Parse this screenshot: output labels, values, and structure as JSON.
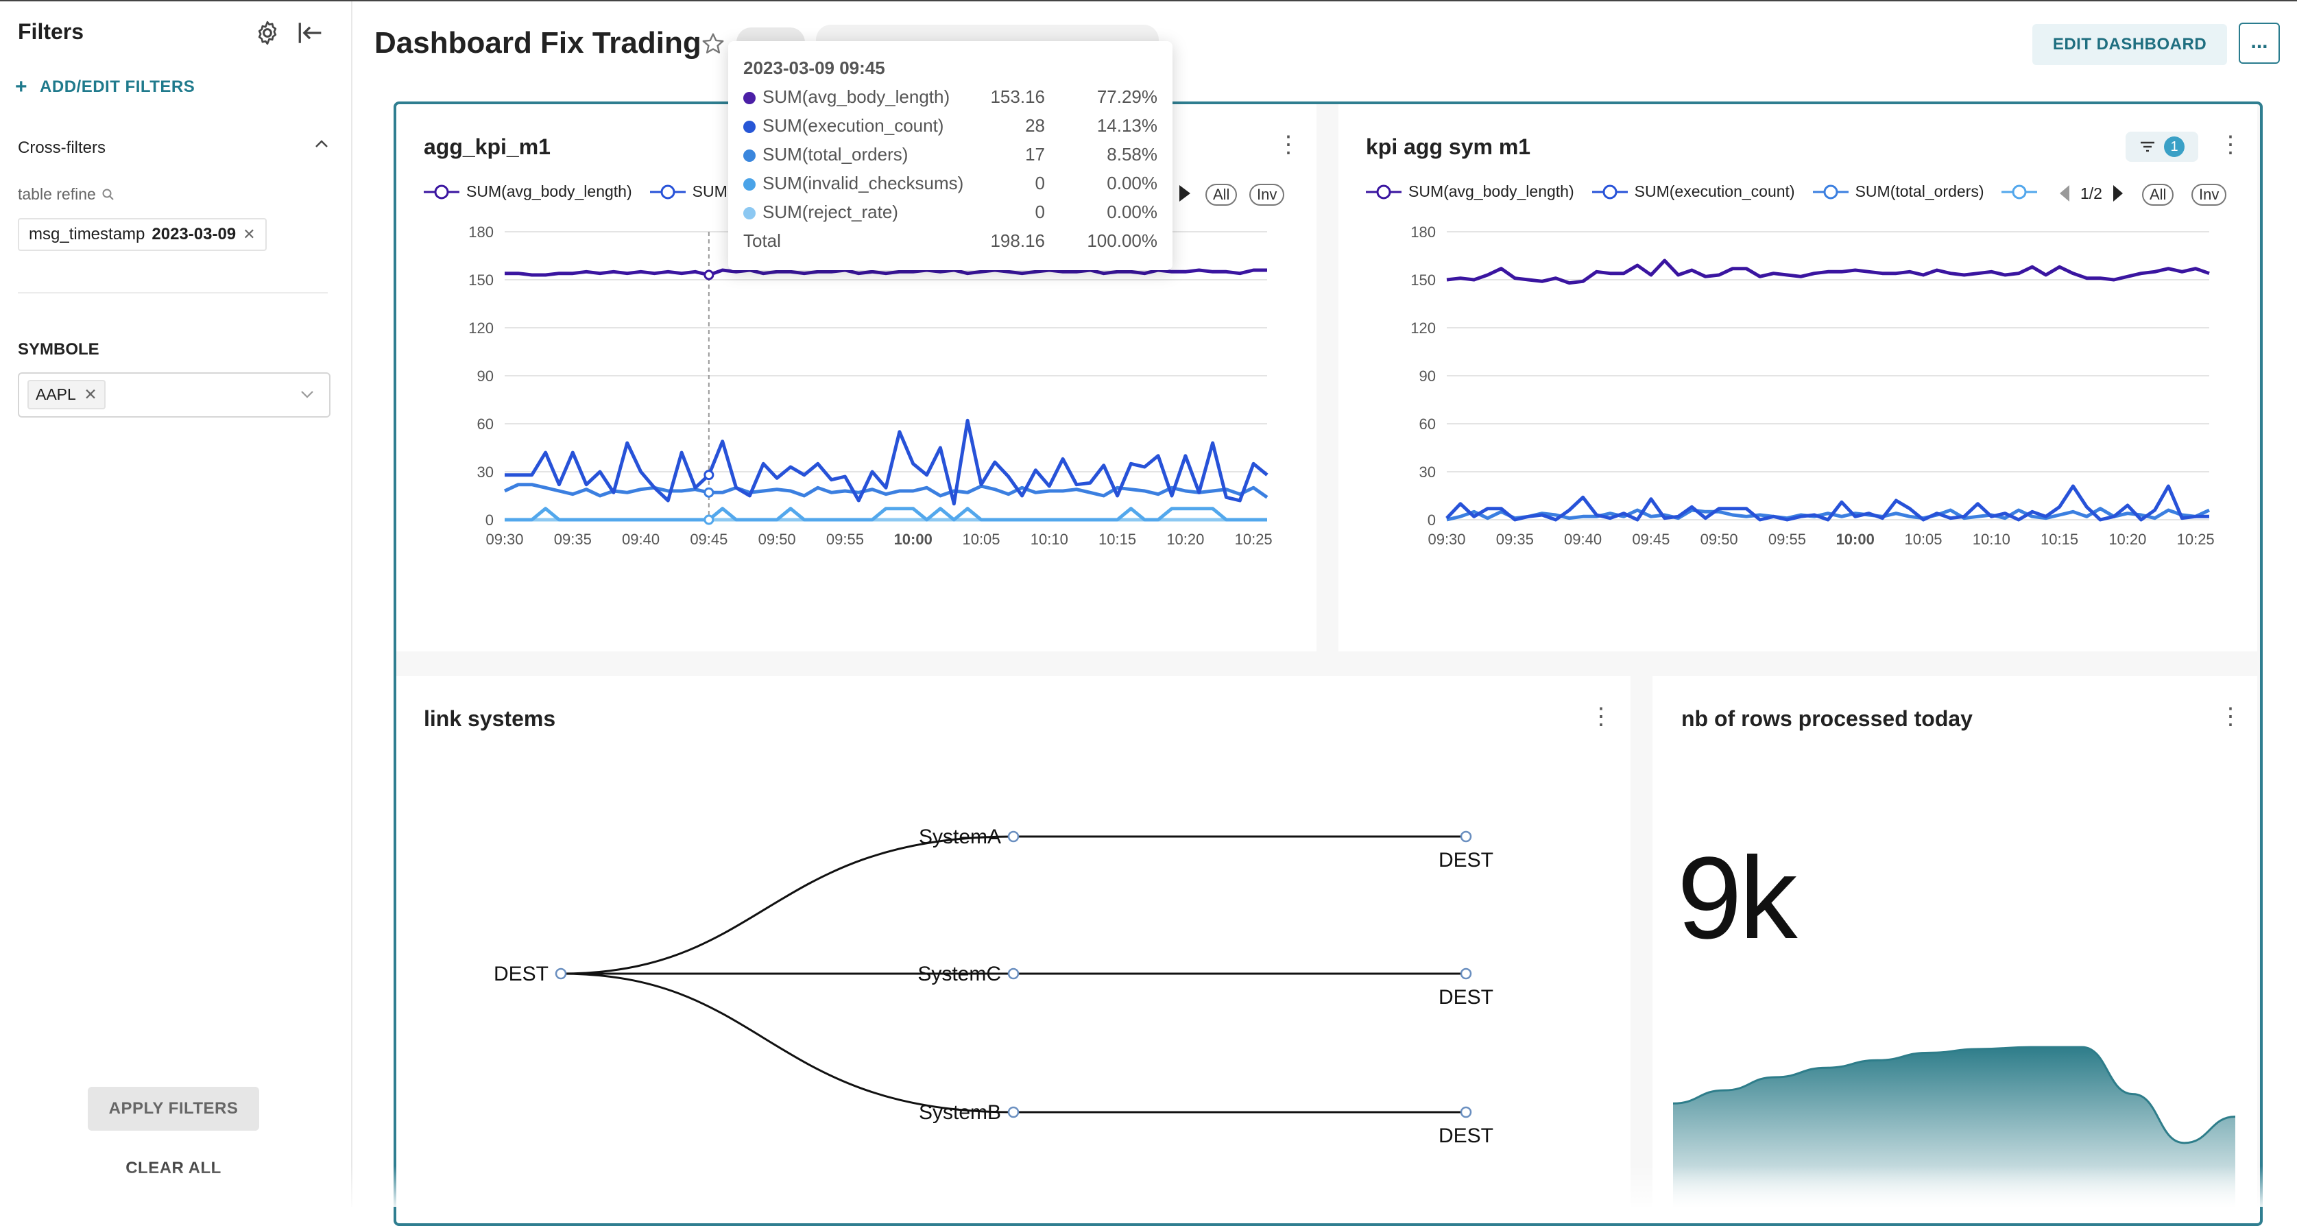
{
  "sidebar": {
    "title": "Filters",
    "add_edit": "ADD/EDIT FILTERS",
    "cross_filters_label": "Cross-filters",
    "table_refine_label": "table refine",
    "cross_filter_chip": {
      "field": "msg_timestamp",
      "value": "2023-03-09"
    },
    "symbole_label": "SYMBOLE",
    "symbole_tag": "AAPL",
    "apply_label": "APPLY FILTERS",
    "clear_label": "CLEAR ALL"
  },
  "header": {
    "title": "Dashboard Fix Trading",
    "edit_label": "EDIT DASHBOARD",
    "more_label": "..."
  },
  "tooltip": {
    "date": "2023-03-09 09:45",
    "rows": [
      {
        "label": "SUM(avg_body_length)",
        "value": "153.16",
        "pct": "77.29%",
        "color": "#4b1fa6"
      },
      {
        "label": "SUM(execution_count)",
        "value": "28",
        "pct": "14.13%",
        "color": "#2756d6"
      },
      {
        "label": "SUM(total_orders)",
        "value": "17",
        "pct": "8.58%",
        "color": "#3a86dd"
      },
      {
        "label": "SUM(invalid_checksums)",
        "value": "0",
        "pct": "0.00%",
        "color": "#4aa3e8"
      },
      {
        "label": "SUM(reject_rate)",
        "value": "0",
        "pct": "0.00%",
        "color": "#8cc8f2"
      }
    ],
    "total_label": "Total",
    "total_value": "198.16",
    "total_pct": "100.00%"
  },
  "chart1": {
    "title": "agg_kpi_m1",
    "legend": [
      "SUM(avg_body_length)",
      "SUM"
    ],
    "all_label": "All",
    "inv_label": "Inv"
  },
  "chart2": {
    "title": "kpi agg sym m1",
    "filter_count": "1",
    "legend": [
      "SUM(avg_body_length)",
      "SUM(execution_count)",
      "SUM(total_orders)"
    ],
    "page_label": "1/2",
    "all_label": "All",
    "inv_label": "Inv"
  },
  "link_systems": {
    "title": "link systems",
    "root": "DEST",
    "systems": [
      "SystemA",
      "SystemC",
      "SystemB"
    ],
    "leaf": "DEST"
  },
  "rows_card": {
    "title": "nb of rows processed today",
    "value": "9k"
  },
  "colors": {
    "accent": "#1f7a8c",
    "series_body": "#3a15a0",
    "series_exec": "#2752d8",
    "series_orders": "#3b7fe0",
    "series_invalid": "#52a7ec",
    "series_reject": "#8cc8f2",
    "area": "#2e7d8a"
  },
  "chart_data": [
    {
      "type": "line",
      "title": "agg_kpi_m1",
      "x": [
        "09:30",
        "09:31",
        "09:32",
        "09:33",
        "09:34",
        "09:35",
        "09:36",
        "09:37",
        "09:38",
        "09:39",
        "09:40",
        "09:41",
        "09:42",
        "09:43",
        "09:44",
        "09:45",
        "09:46",
        "09:47",
        "09:48",
        "09:49",
        "09:50",
        "09:51",
        "09:52",
        "09:53",
        "09:54",
        "09:55",
        "09:56",
        "09:57",
        "09:58",
        "09:59",
        "10:00",
        "10:01",
        "10:02",
        "10:03",
        "10:04",
        "10:05",
        "10:06",
        "10:07",
        "10:08",
        "10:09",
        "10:10",
        "10:11",
        "10:12",
        "10:13",
        "10:14",
        "10:15",
        "10:16",
        "10:17",
        "10:18",
        "10:19",
        "10:20",
        "10:21",
        "10:22",
        "10:23",
        "10:24",
        "10:25",
        "10:26"
      ],
      "x_ticks": [
        "09:30",
        "09:35",
        "09:40",
        "09:45",
        "09:50",
        "09:55",
        "10:00",
        "10:05",
        "10:10",
        "10:15",
        "10:20",
        "10:25"
      ],
      "ylim": [
        0,
        180
      ],
      "y_ticks": [
        0,
        30,
        60,
        90,
        120,
        150,
        180
      ],
      "series": [
        {
          "name": "SUM(avg_body_length)",
          "values": [
            154,
            154,
            153,
            153,
            154,
            154,
            155,
            154,
            155,
            154,
            155,
            154,
            155,
            154,
            155,
            153,
            156,
            155,
            156,
            154,
            155,
            155,
            154,
            155,
            155,
            156,
            154,
            155,
            154,
            155,
            155,
            156,
            155,
            156,
            154,
            155,
            156,
            155,
            154,
            155,
            156,
            155,
            155,
            156,
            154,
            155,
            155,
            154,
            156,
            155,
            155,
            156,
            155,
            155,
            154,
            156,
            156
          ]
        },
        {
          "name": "SUM(execution_count)",
          "values": [
            28,
            28,
            28,
            42,
            22,
            42,
            22,
            30,
            17,
            48,
            30,
            20,
            12,
            42,
            20,
            28,
            49,
            20,
            15,
            35,
            26,
            33,
            28,
            35,
            25,
            27,
            12,
            30,
            20,
            55,
            35,
            28,
            45,
            10,
            62,
            22,
            36,
            27,
            15,
            31,
            21,
            38,
            22,
            23,
            34,
            15,
            35,
            33,
            40,
            15,
            40,
            17,
            48,
            14,
            12,
            35,
            28
          ]
        },
        {
          "name": "SUM(total_orders)",
          "values": [
            18,
            22,
            22,
            20,
            18,
            16,
            19,
            15,
            18,
            17,
            19,
            20,
            18,
            18,
            19,
            17,
            17,
            20,
            17,
            18,
            19,
            18,
            15,
            20,
            17,
            18,
            17,
            19,
            16,
            18,
            18,
            20,
            15,
            18,
            17,
            21,
            19,
            16,
            20,
            17,
            18,
            18,
            19,
            17,
            15,
            20,
            19,
            18,
            16,
            20,
            18,
            17,
            18,
            19,
            16,
            20,
            14
          ]
        },
        {
          "name": "SUM(invalid_checksums)",
          "values": [
            0,
            0,
            0,
            7,
            0,
            0,
            0,
            0,
            0,
            0,
            0,
            0,
            0,
            0,
            0,
            0,
            7,
            0,
            0,
            0,
            0,
            7,
            0,
            0,
            0,
            0,
            0,
            0,
            7,
            7,
            7,
            0,
            7,
            0,
            7,
            0,
            0,
            0,
            0,
            0,
            0,
            0,
            0,
            0,
            0,
            0,
            7,
            0,
            0,
            7,
            7,
            7,
            7,
            0,
            0,
            0,
            0
          ]
        },
        {
          "name": "SUM(reject_rate)",
          "values": [
            0,
            0,
            0,
            0,
            0,
            0,
            0,
            0,
            0,
            0,
            0,
            0,
            0,
            0,
            0,
            0,
            0,
            0,
            0,
            0,
            0,
            0,
            0,
            0,
            0,
            0,
            0,
            0,
            0,
            0,
            0,
            0,
            0,
            0,
            0,
            0,
            0,
            0,
            0,
            0,
            0,
            0,
            0,
            0,
            0,
            0,
            0,
            0,
            0,
            0,
            0,
            0,
            0,
            0,
            0,
            0,
            0
          ]
        }
      ]
    },
    {
      "type": "line",
      "title": "kpi agg sym m1",
      "x": [
        "09:30",
        "09:31",
        "09:32",
        "09:33",
        "09:34",
        "09:35",
        "09:36",
        "09:37",
        "09:38",
        "09:39",
        "09:40",
        "09:41",
        "09:42",
        "09:43",
        "09:44",
        "09:45",
        "09:46",
        "09:47",
        "09:48",
        "09:49",
        "09:50",
        "09:51",
        "09:52",
        "09:53",
        "09:54",
        "09:55",
        "09:56",
        "09:57",
        "09:58",
        "09:59",
        "10:00",
        "10:01",
        "10:02",
        "10:03",
        "10:04",
        "10:05",
        "10:06",
        "10:07",
        "10:08",
        "10:09",
        "10:10",
        "10:11",
        "10:12",
        "10:13",
        "10:14",
        "10:15",
        "10:16",
        "10:17",
        "10:18",
        "10:19",
        "10:20",
        "10:21",
        "10:22",
        "10:23",
        "10:24",
        "10:25",
        "10:26"
      ],
      "x_ticks": [
        "09:30",
        "09:35",
        "09:40",
        "09:45",
        "09:50",
        "09:55",
        "10:00",
        "10:05",
        "10:10",
        "10:15",
        "10:20",
        "10:25"
      ],
      "ylim": [
        0,
        180
      ],
      "y_ticks": [
        0,
        30,
        60,
        90,
        120,
        150,
        180
      ],
      "series": [
        {
          "name": "SUM(avg_body_length)",
          "values": [
            150,
            151,
            150,
            153,
            157,
            151,
            150,
            149,
            151,
            148,
            149,
            155,
            154,
            154,
            159,
            153,
            162,
            153,
            156,
            152,
            153,
            157,
            157,
            152,
            154,
            153,
            152,
            154,
            155,
            155,
            156,
            155,
            154,
            154,
            155,
            153,
            156,
            154,
            153,
            154,
            155,
            153,
            154,
            158,
            153,
            158,
            154,
            151,
            151,
            150,
            152,
            154,
            155,
            157,
            155,
            157,
            154
          ]
        },
        {
          "name": "SUM(execution_count)",
          "values": [
            1,
            10,
            2,
            7,
            7,
            0,
            2,
            3,
            0,
            6,
            14,
            3,
            1,
            4,
            0,
            13,
            1,
            2,
            8,
            1,
            7,
            7,
            7,
            0,
            2,
            0,
            2,
            3,
            0,
            11,
            2,
            4,
            1,
            12,
            7,
            0,
            4,
            1,
            2,
            10,
            2,
            4,
            0,
            5,
            2,
            8,
            21,
            8,
            0,
            2,
            9,
            0,
            6,
            21,
            1,
            2,
            2
          ]
        },
        {
          "name": "SUM(total_orders)",
          "values": [
            0,
            2,
            5,
            1,
            5,
            1,
            2,
            4,
            3,
            1,
            2,
            2,
            4,
            2,
            6,
            2,
            3,
            1,
            6,
            5,
            5,
            3,
            2,
            3,
            2,
            1,
            3,
            2,
            4,
            2,
            4,
            3,
            2,
            4,
            2,
            1,
            3,
            6,
            1,
            2,
            3,
            1,
            6,
            2,
            1,
            3,
            5,
            2,
            7,
            2,
            4,
            3,
            1,
            6,
            3,
            2,
            6
          ]
        }
      ]
    },
    {
      "type": "area",
      "title": "nb of rows processed today",
      "x": [
        0,
        1,
        2,
        3,
        4,
        5,
        6,
        7,
        8,
        9,
        10,
        11
      ],
      "values": [
        0.55,
        0.62,
        0.69,
        0.74,
        0.78,
        0.82,
        0.84,
        0.85,
        0.85,
        0.6,
        0.34,
        0.48
      ],
      "ylim": [
        0,
        1
      ]
    }
  ]
}
